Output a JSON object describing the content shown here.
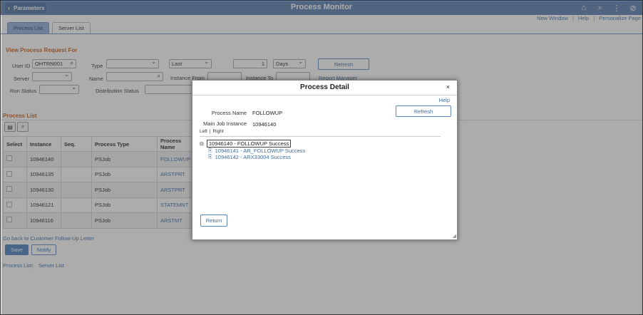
{
  "header": {
    "back_label": "Parameters",
    "title": "Process Monitor",
    "icons": [
      "home-icon",
      "search-icon",
      "more-icon",
      "navbar-icon"
    ]
  },
  "toplinks": [
    "New Window",
    "Help",
    "Personalize Page"
  ],
  "tabs": [
    "Process List",
    "Server List"
  ],
  "request": {
    "section_title": "View Process Request For",
    "user_id_label": "User ID",
    "user_id_value": "OHTRN001",
    "type_label": "Type",
    "type_value": "",
    "last_value": "Last",
    "count_value": "1",
    "days_value": "Days",
    "refresh_label": "Refresh",
    "server_label": "Server",
    "name_label": "Name",
    "instance_from_label": "Instance From",
    "instance_to_label": "Instance To",
    "report_manager_label": "Report Manager",
    "run_status_label": "Run Status",
    "distribution_status_label": "Distribution Status"
  },
  "process_list": {
    "section_title": "Process List",
    "columns": [
      "Select",
      "Instance",
      "Seq.",
      "Process Type",
      "Process Name"
    ],
    "rows": [
      {
        "instance": "10946140",
        "seq": "",
        "type": "PSJob",
        "name": "FOLLOWUP"
      },
      {
        "instance": "10946135",
        "seq": "",
        "type": "PSJob",
        "name": "ARSTPRT"
      },
      {
        "instance": "10946130",
        "seq": "",
        "type": "PSJob",
        "name": "ARSTPRT"
      },
      {
        "instance": "10946121",
        "seq": "",
        "type": "PSJob",
        "name": "STATEMNT"
      },
      {
        "instance": "10946116",
        "seq": "",
        "type": "PSJob",
        "name": "ARSTMT"
      }
    ]
  },
  "footer": {
    "go_back_link": "Go back to Customer Follow-Up Letter",
    "save_label": "Save",
    "notify_label": "Notify",
    "bottom_links": [
      "Process List",
      "Server List"
    ]
  },
  "modal": {
    "title": "Process Detail",
    "close_glyph": "×",
    "help_label": "Help",
    "process_name_label": "Process Name",
    "process_name_value": "FOLLOWUP",
    "refresh_label": "Refresh",
    "main_job_instance_label": "Main Job Instance",
    "main_job_instance_value": "10946140",
    "left_label": "Left",
    "right_label": "Right",
    "tree_root": "10946140 - FOLLOWUP Success",
    "tree_children": [
      "10946141 - AR_FOLLOWUP Success",
      "10946142 - ARX33004 Success"
    ],
    "return_label": "Return"
  },
  "colors": {
    "header_bg": "#5b7fb0",
    "accent_link": "#3a6ea5",
    "section_title": "#c35e1b",
    "primary_button": "#4a7cbf"
  }
}
